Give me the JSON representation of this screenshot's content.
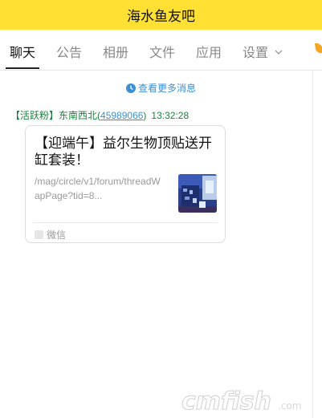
{
  "header": {
    "title": "海水鱼友吧"
  },
  "tabs": [
    {
      "label": "聊天",
      "active": true
    },
    {
      "label": "公告"
    },
    {
      "label": "相册"
    },
    {
      "label": "文件"
    },
    {
      "label": "应用"
    },
    {
      "label": "设置"
    }
  ],
  "more_messages": "查看更多消息",
  "message": {
    "badge": "【活跃粉】",
    "sender_name": "东南西北",
    "uid_open": "(",
    "uid": "45989066",
    "uid_close": ")",
    "time": "13:32:28",
    "card": {
      "title": "【迎端午】益尔生物顶贴送开缸套装！",
      "url": "/mag/circle/v1/forum/threadWapPage?tid=8...",
      "source": "微信"
    }
  },
  "watermark": {
    "text": "cmfish"
  },
  "colors": {
    "title_bar": "#ffe033",
    "link": "#3b8fd6",
    "sender": "#1a7f3c"
  }
}
